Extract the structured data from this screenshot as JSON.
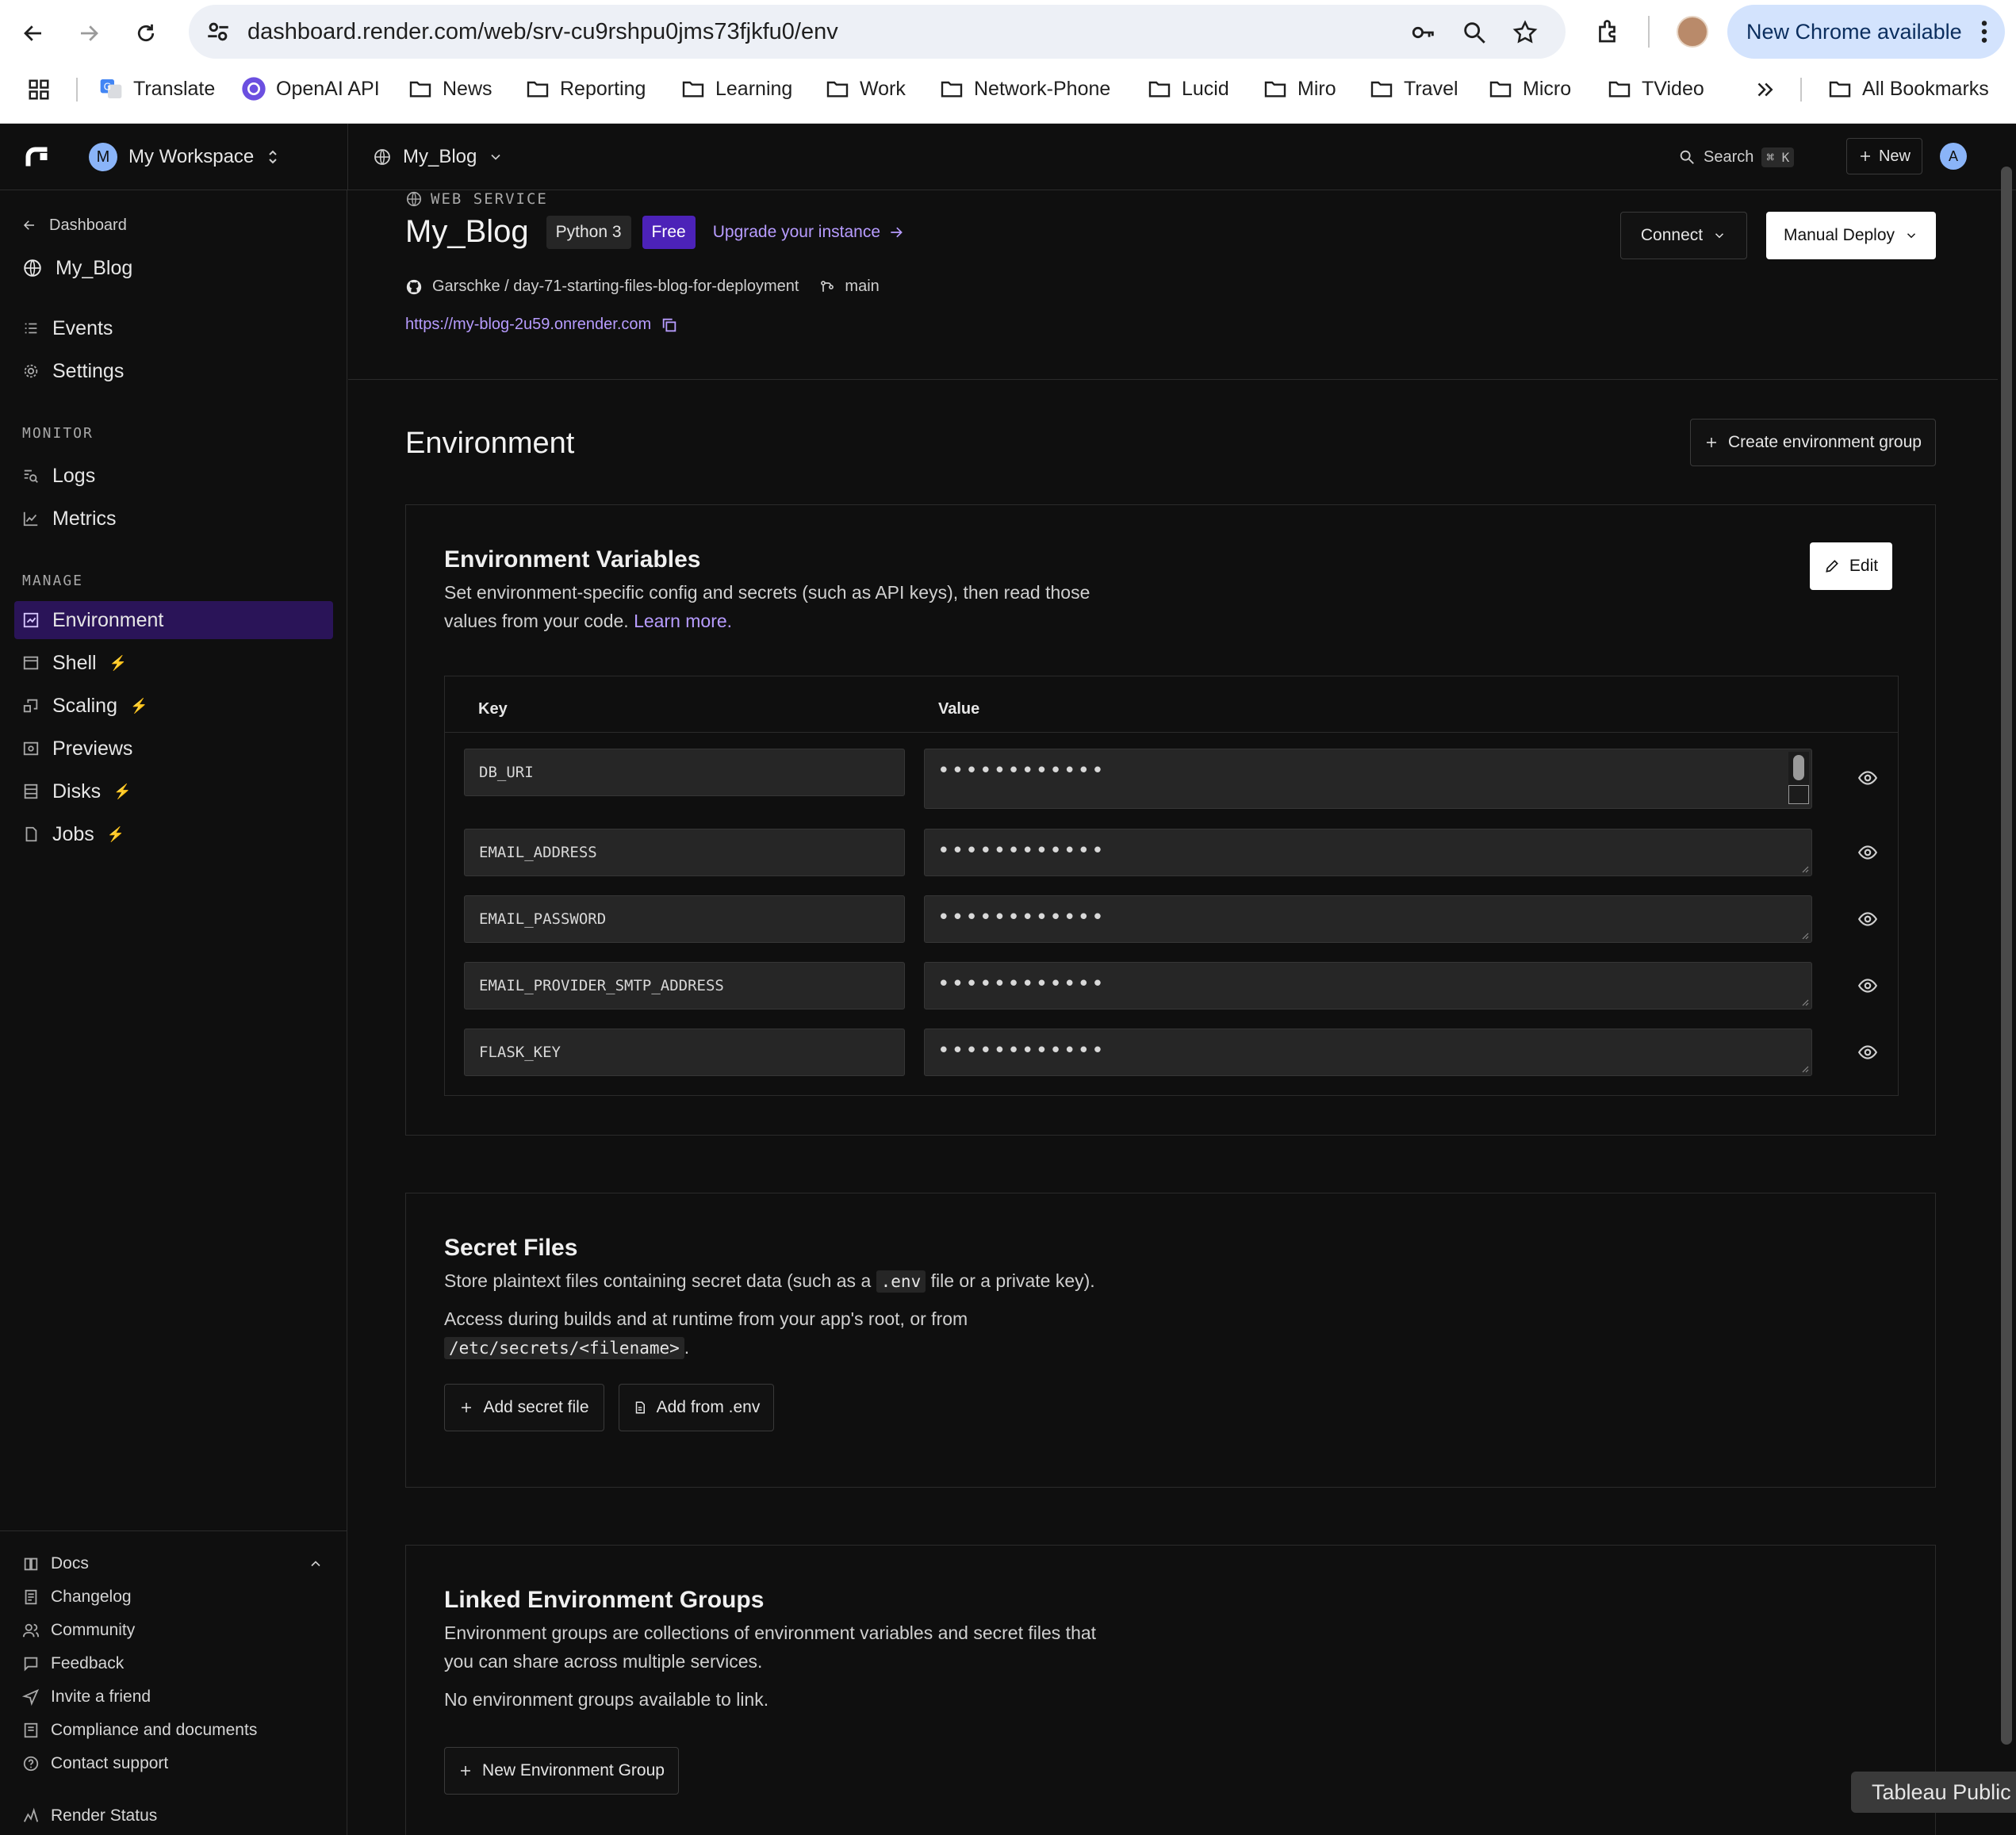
{
  "browser": {
    "url": "dashboard.render.com/web/srv-cu9rshpu0jms73fjkfu0/env",
    "new_chrome_label": "New Chrome available",
    "bookmarks": [
      "Translate",
      "OpenAI API",
      "News",
      "Reporting",
      "Learning",
      "Work",
      "Network-Phone",
      "Lucid",
      "Miro",
      "Travel",
      "Micro",
      "TVideo"
    ],
    "all_bookmarks_label": "All Bookmarks"
  },
  "header": {
    "workspace_initial": "M",
    "workspace_name": "My Workspace",
    "service_name": "My_Blog",
    "search_label": "Search",
    "search_shortcut": "⌘ K",
    "new_label": "New",
    "user_initial": "A"
  },
  "sidebar": {
    "back_label": "Dashboard",
    "service_label": "My_Blog",
    "top_items": [
      "Events",
      "Settings"
    ],
    "monitor_label": "MONITOR",
    "monitor_items": [
      "Logs",
      "Metrics"
    ],
    "manage_label": "MANAGE",
    "manage_items": [
      "Environment",
      "Shell",
      "Scaling",
      "Previews",
      "Disks",
      "Jobs"
    ],
    "bolt": "⚡",
    "footer_items": [
      "Docs",
      "Changelog",
      "Community",
      "Feedback",
      "Invite a friend",
      "Compliance and documents",
      "Contact support",
      "Render Status"
    ]
  },
  "service": {
    "type_label": "WEB SERVICE",
    "name": "My_Blog",
    "runtime_badge": "Python 3",
    "plan_badge": "Free",
    "upgrade_label": "Upgrade your instance",
    "repo": "Garschke / day-71-starting-files-blog-for-deployment",
    "branch": "main",
    "url": "https://my-blog-2u59.onrender.com",
    "connect_label": "Connect",
    "deploy_label": "Manual Deploy"
  },
  "environment": {
    "title": "Environment",
    "create_group_label": "Create environment group",
    "vars_title": "Environment Variables",
    "vars_desc_1": "Set environment-specific config and secrets (such as API keys), then read those",
    "vars_desc_2": "values from your code.",
    "learn_more": "Learn more.",
    "edit_label": "Edit",
    "col_key": "Key",
    "col_value": "Value",
    "variables": [
      {
        "key": "DB_URI",
        "value": "••••••••••••"
      },
      {
        "key": "EMAIL_ADDRESS",
        "value": "••••••••••••"
      },
      {
        "key": "EMAIL_PASSWORD",
        "value": "••••••••••••"
      },
      {
        "key": "EMAIL_PROVIDER_SMTP_ADDRESS",
        "value": "••••••••••••"
      },
      {
        "key": "FLASK_KEY",
        "value": "••••••••••••"
      }
    ]
  },
  "secret_files": {
    "title": "Secret Files",
    "desc_a": "Store plaintext files containing secret data (such as a",
    "desc_code": ".env",
    "desc_b": "file or a private key).",
    "desc_2": "Access during builds and at runtime from your app's root, or from",
    "path_code": "/etc/secrets/<filename>",
    "add_file_label": "Add secret file",
    "add_env_label": "Add from .env"
  },
  "linked_groups": {
    "title": "Linked Environment Groups",
    "desc_1": "Environment groups are collections of environment variables and secret files that",
    "desc_2": "you can share across multiple services.",
    "empty": "No environment groups available to link.",
    "new_group_label": "New Environment Group"
  },
  "overlay": {
    "tableau_label": "Tableau Public"
  }
}
